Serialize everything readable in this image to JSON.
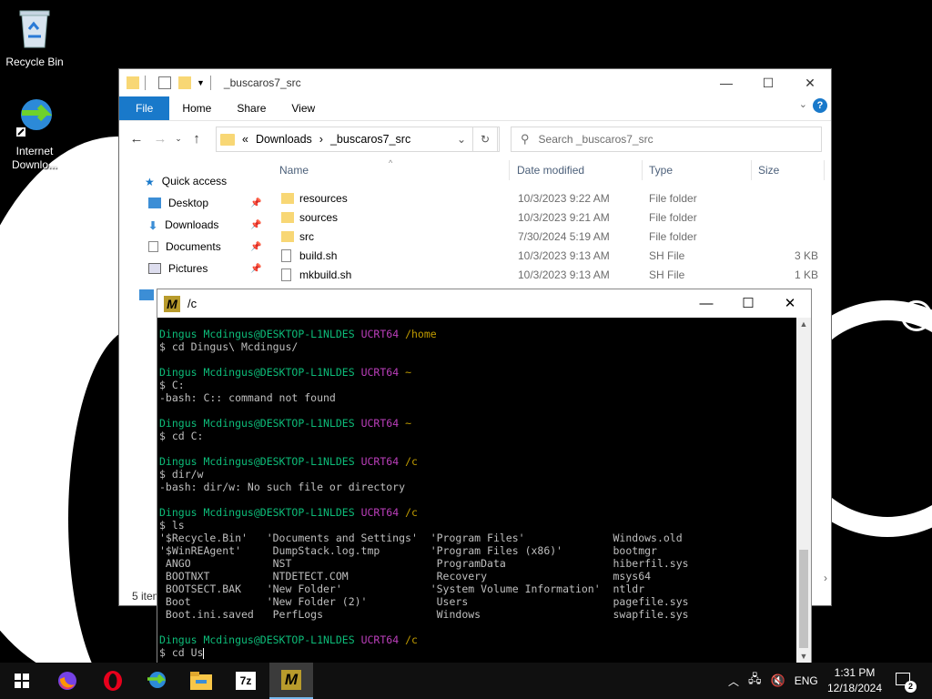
{
  "desktop": {
    "icons": [
      {
        "label": "Recycle Bin"
      },
      {
        "label": "Internet Downlo..."
      }
    ]
  },
  "explorer": {
    "title": "_buscaros7_src",
    "ribbon_tabs": [
      "File",
      "Home",
      "Share",
      "View"
    ],
    "help": "?",
    "address": {
      "prefix": "«",
      "crumbs": [
        "Downloads",
        "›",
        "_buscaros7_src"
      ]
    },
    "search_placeholder": "Search _buscaros7_src",
    "nav": [
      {
        "label": "Quick access",
        "pinned": false
      },
      {
        "label": "Desktop",
        "pinned": true
      },
      {
        "label": "Downloads",
        "pinned": true
      },
      {
        "label": "Documents",
        "pinned": true
      },
      {
        "label": "Pictures",
        "pinned": true
      }
    ],
    "columns": {
      "name": "Name",
      "date": "Date modified",
      "type": "Type",
      "size": "Size"
    },
    "files": [
      {
        "name": "resources",
        "date": "10/3/2023 9:22 AM",
        "type": "File folder",
        "size": "",
        "kind": "folder"
      },
      {
        "name": "sources",
        "date": "10/3/2023 9:21 AM",
        "type": "File folder",
        "size": "",
        "kind": "folder"
      },
      {
        "name": "src",
        "date": "7/30/2024 5:19 AM",
        "type": "File folder",
        "size": "",
        "kind": "folder"
      },
      {
        "name": "build.sh",
        "date": "10/3/2023 9:13 AM",
        "type": "SH File",
        "size": "3 KB",
        "kind": "file"
      },
      {
        "name": "mkbuild.sh",
        "date": "10/3/2023 9:13 AM",
        "type": "SH File",
        "size": "1 KB",
        "kind": "file"
      }
    ],
    "status": "5 item"
  },
  "terminal": {
    "title": "/c",
    "user": "Dingus Mcdingus@DESKTOP-L1NLDES",
    "env": "UCRT64",
    "blocks": [
      {
        "path": "/home",
        "cmd": "$ cd Dingus\\ Mcdingus/",
        "out": []
      },
      {
        "path": "~",
        "cmd": "$ C:",
        "out": [
          "-bash: C:: command not found"
        ]
      },
      {
        "path": "~",
        "cmd": "$ cd C:",
        "out": []
      },
      {
        "path": "/c",
        "cmd": "$ dir/w",
        "out": [
          "-bash: dir/w: No such file or directory"
        ]
      },
      {
        "path": "/c",
        "cmd": "$ ls",
        "out": [
          "'$Recycle.Bin'   'Documents and Settings'  'Program Files'              Windows.old",
          "'$WinREAgent'     DumpStack.log.tmp        'Program Files (x86)'        bootmgr",
          " ANGO             NST                       ProgramData                 hiberfil.sys",
          " BOOTNXT          NTDETECT.COM              Recovery                    msys64",
          " BOOTSECT.BAK    'New Folder'              'System Volume Information'  ntldr",
          " Boot            'New Folder (2)'           Users                       pagefile.sys",
          " Boot.ini.saved   PerfLogs                  Windows                     swapfile.sys"
        ]
      },
      {
        "path": "/c",
        "cmd": "$ cd Us",
        "out": []
      }
    ]
  },
  "taskbar": {
    "apps": [
      "start-button",
      "firefox",
      "opera",
      "internet-download-manager",
      "file-explorer",
      "7zip",
      "msys2-mintty"
    ],
    "tray": {
      "lang": "ENG",
      "time": "1:31 PM",
      "date": "12/18/2024",
      "notification_count": "2"
    }
  },
  "colors": {
    "accent": "#1979ca",
    "prompt_user": "#0dbc79",
    "prompt_env": "#bc3fbc",
    "prompt_path": "#c19c00"
  }
}
